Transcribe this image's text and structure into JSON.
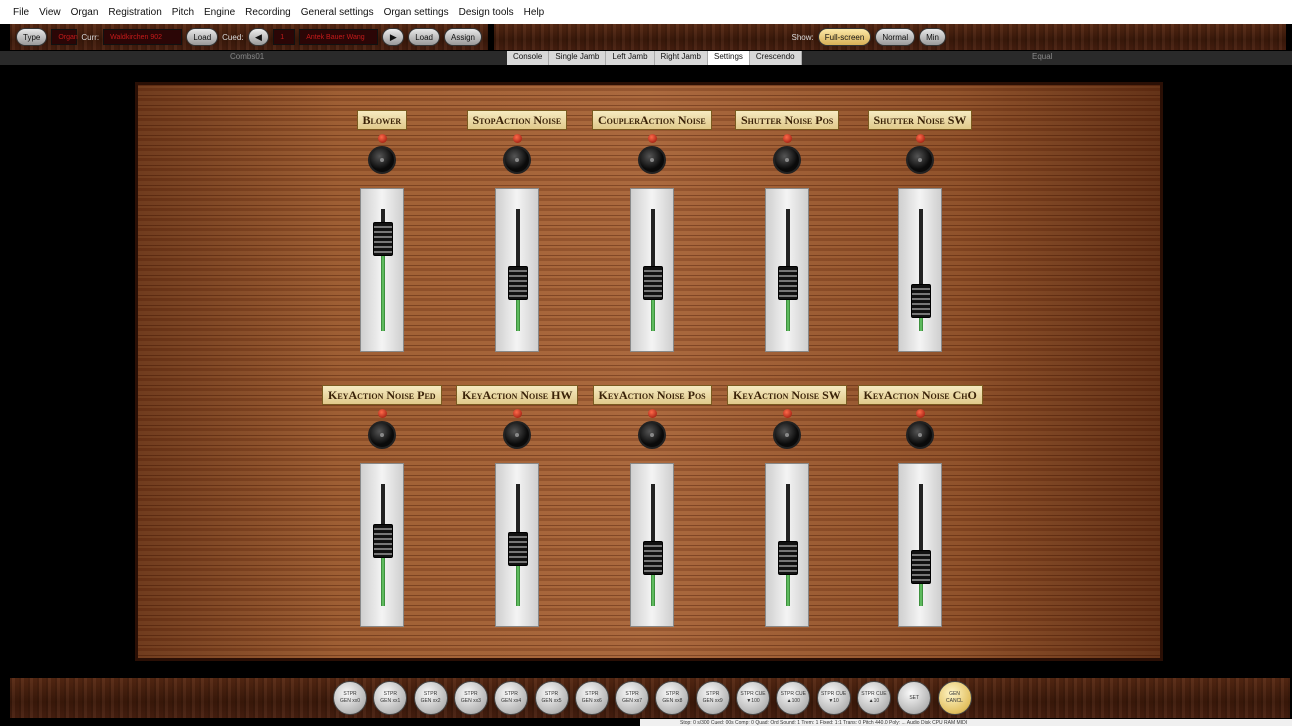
{
  "menu": [
    "File",
    "View",
    "Organ",
    "Registration",
    "Pitch",
    "Engine",
    "Recording",
    "General settings",
    "Organ settings",
    "Design tools",
    "Help"
  ],
  "toolbar": {
    "type_label": "Type",
    "organ_field": "Organ",
    "curr_label": "Curr:",
    "curr_value": "Waldkirchen 902",
    "load_label": "Load",
    "cued_label": "Cued:",
    "cued_num": "1",
    "cued_value": "Antek Bauer Wang",
    "load2_label": "Load",
    "assign_label": "Assign",
    "show_label": "Show:",
    "fullscreen_label": "Full-screen",
    "normal_label": "Normal",
    "min_label": "Min"
  },
  "tabstrip": {
    "left_text": "Combs01",
    "right_text": "Equal",
    "tabs": [
      "Console",
      "Single Jamb",
      "Left Jamb",
      "Right Jamb",
      "Settings",
      "Crescendo"
    ],
    "selected": "Settings"
  },
  "controls": [
    {
      "label": "Blower",
      "level": 0.85
    },
    {
      "label": "StopAction Noise",
      "level": 0.35
    },
    {
      "label": "CouplerAction Noise",
      "level": 0.35
    },
    {
      "label": "Shutter Noise Pos",
      "level": 0.35
    },
    {
      "label": "Shutter Noise SW",
      "level": 0.15
    },
    {
      "label": "KeyAction Noise Ped",
      "level": 0.55
    },
    {
      "label": "KeyAction Noise HW",
      "level": 0.45
    },
    {
      "label": "KeyAction Noise Pos",
      "level": 0.35
    },
    {
      "label": "KeyAction Noise SW",
      "level": 0.35
    },
    {
      "label": "KeyAction Noise ChO",
      "level": 0.25
    }
  ],
  "gen_buttons": [
    [
      "STPR",
      "GEN xx0"
    ],
    [
      "STPR",
      "GEN xx1"
    ],
    [
      "STPR",
      "GEN xx2"
    ],
    [
      "STPR",
      "GEN xx3"
    ],
    [
      "STPR",
      "GEN xx4"
    ],
    [
      "STPR",
      "GEN xx5"
    ],
    [
      "STPR",
      "GEN xx6"
    ],
    [
      "STPR",
      "GEN xx7"
    ],
    [
      "STPR",
      "GEN xx8"
    ],
    [
      "STPR",
      "GEN xx9"
    ],
    [
      "STPR CUE",
      "▼100"
    ],
    [
      "STPR CUE",
      "▲100"
    ],
    [
      "STPR CUE",
      "▼10"
    ],
    [
      "STPR CUE",
      "▲10"
    ],
    [
      "SET",
      ""
    ],
    [
      "GEN",
      "CANCL"
    ]
  ],
  "status": "Stop: 0  s/300  Cued: 00s  Comp: 0  Quad: Ord  Sound: 1  Trem: 1  Fixed: 1:1  Trans: 0  Pitch 440.0  Poly:  ...  Audio  Disk  CPU  RAM  MIDI"
}
